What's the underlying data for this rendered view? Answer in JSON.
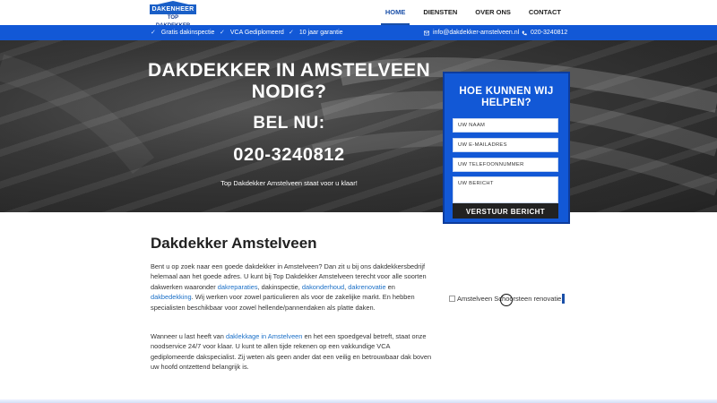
{
  "logo": {
    "line1": "DAKENHEER",
    "line2": "TOP DAKDEKKER"
  },
  "nav": {
    "items": [
      "HOME",
      "DIENSTEN",
      "OVER ONS",
      "CONTACT"
    ]
  },
  "infobar": {
    "items": [
      "Gratis dakinspectie",
      "VCA Gediplomeerd",
      "10 jaar garantie"
    ],
    "email": "info@dakdekker-amstelveen.nl",
    "phone": "020-3240812",
    "email_icon": "envelope-icon",
    "phone_icon": "phone-icon",
    "check_icon": "check-icon"
  },
  "hero": {
    "title": "DAKDEKKER IN AMSTELVEEN NODIG?",
    "call_label": "BEL NU:",
    "phone": "020-3240812",
    "subtitle": "Top Dakdekker Amstelveen staat voor u klaar!"
  },
  "form": {
    "title": "HOE KUNNEN WIJ HELPEN?",
    "fields": {
      "name": "UW NAAM",
      "email": "UW E-MAILADRES",
      "phone": "UW TELEFOONNUMMER",
      "message": "UW BERICHT"
    },
    "submit": "VERSTUUR BERICHT"
  },
  "content": {
    "heading": "Dakdekker Amstelveen",
    "p1": {
      "text1": "Bent u op zoek naar een goede dakdekker in Amstelveen? Dan zit u bij ons dakdekkersbedrijf helemaal aan het goede adres. U kunt bij Top Dakdekker Amstelveen terecht voor alle soorten dakwerken waaronder ",
      "link1": "dakreparaties",
      "text2": ", dakinspectie, ",
      "link2": "dakonderhoud",
      "text3": ", ",
      "link3": "dakrenovatie",
      "text4": " en ",
      "link4": "dakbedekking",
      "text5": ". Wij werken voor zowel particulieren als voor de zakelijke markt. En hebben specialisten beschikbaar voor zowel hellende/pannendaken als platte daken."
    },
    "p2": {
      "text1": "Wanneer u last heeft van ",
      "link1": "daklekkage in Amstelveen",
      "text2": " en het een spoedgeval betreft, staat onze noodservice 24/7 voor klaar. U kunt te allen tijde rekenen op een vakkundige VCA gediplomeerde dakspecialist. Zij weten als geen ander dat een veilig en betrouwbaar dak boven uw hoofd ontzettend belangrijk is."
    },
    "image_alt": "Amstelveen Schoorsteen renovatie"
  },
  "colors": {
    "brand_blue": "#1258d6",
    "link": "#1a6fc7",
    "dark": "#222222"
  }
}
